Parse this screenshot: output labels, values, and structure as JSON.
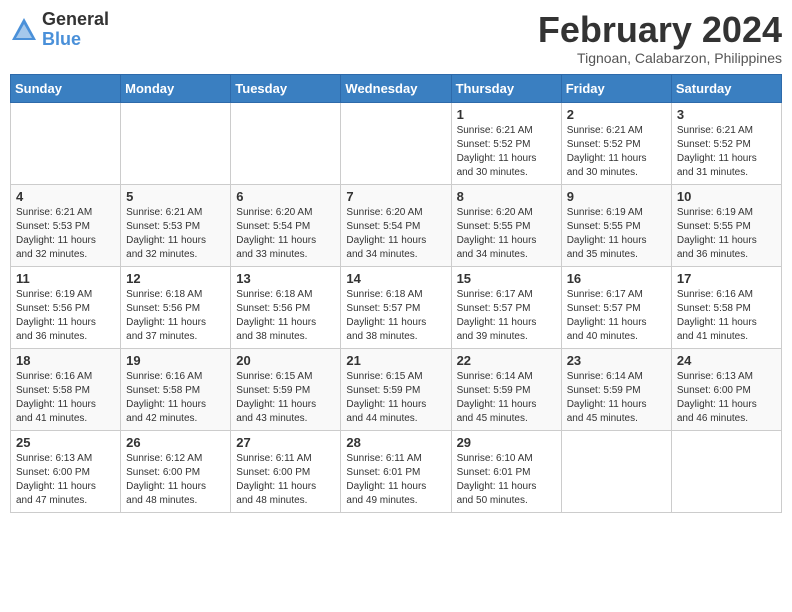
{
  "logo": {
    "text_general": "General",
    "text_blue": "Blue"
  },
  "header": {
    "month_title": "February 2024",
    "location": "Tignoan, Calabarzon, Philippines"
  },
  "days_of_week": [
    "Sunday",
    "Monday",
    "Tuesday",
    "Wednesday",
    "Thursday",
    "Friday",
    "Saturday"
  ],
  "weeks": [
    [
      {
        "day": "",
        "info": ""
      },
      {
        "day": "",
        "info": ""
      },
      {
        "day": "",
        "info": ""
      },
      {
        "day": "",
        "info": ""
      },
      {
        "day": "1",
        "info": "Sunrise: 6:21 AM\nSunset: 5:52 PM\nDaylight: 11 hours and 30 minutes."
      },
      {
        "day": "2",
        "info": "Sunrise: 6:21 AM\nSunset: 5:52 PM\nDaylight: 11 hours and 30 minutes."
      },
      {
        "day": "3",
        "info": "Sunrise: 6:21 AM\nSunset: 5:52 PM\nDaylight: 11 hours and 31 minutes."
      }
    ],
    [
      {
        "day": "4",
        "info": "Sunrise: 6:21 AM\nSunset: 5:53 PM\nDaylight: 11 hours and 32 minutes."
      },
      {
        "day": "5",
        "info": "Sunrise: 6:21 AM\nSunset: 5:53 PM\nDaylight: 11 hours and 32 minutes."
      },
      {
        "day": "6",
        "info": "Sunrise: 6:20 AM\nSunset: 5:54 PM\nDaylight: 11 hours and 33 minutes."
      },
      {
        "day": "7",
        "info": "Sunrise: 6:20 AM\nSunset: 5:54 PM\nDaylight: 11 hours and 34 minutes."
      },
      {
        "day": "8",
        "info": "Sunrise: 6:20 AM\nSunset: 5:55 PM\nDaylight: 11 hours and 34 minutes."
      },
      {
        "day": "9",
        "info": "Sunrise: 6:19 AM\nSunset: 5:55 PM\nDaylight: 11 hours and 35 minutes."
      },
      {
        "day": "10",
        "info": "Sunrise: 6:19 AM\nSunset: 5:55 PM\nDaylight: 11 hours and 36 minutes."
      }
    ],
    [
      {
        "day": "11",
        "info": "Sunrise: 6:19 AM\nSunset: 5:56 PM\nDaylight: 11 hours and 36 minutes."
      },
      {
        "day": "12",
        "info": "Sunrise: 6:18 AM\nSunset: 5:56 PM\nDaylight: 11 hours and 37 minutes."
      },
      {
        "day": "13",
        "info": "Sunrise: 6:18 AM\nSunset: 5:56 PM\nDaylight: 11 hours and 38 minutes."
      },
      {
        "day": "14",
        "info": "Sunrise: 6:18 AM\nSunset: 5:57 PM\nDaylight: 11 hours and 38 minutes."
      },
      {
        "day": "15",
        "info": "Sunrise: 6:17 AM\nSunset: 5:57 PM\nDaylight: 11 hours and 39 minutes."
      },
      {
        "day": "16",
        "info": "Sunrise: 6:17 AM\nSunset: 5:57 PM\nDaylight: 11 hours and 40 minutes."
      },
      {
        "day": "17",
        "info": "Sunrise: 6:16 AM\nSunset: 5:58 PM\nDaylight: 11 hours and 41 minutes."
      }
    ],
    [
      {
        "day": "18",
        "info": "Sunrise: 6:16 AM\nSunset: 5:58 PM\nDaylight: 11 hours and 41 minutes."
      },
      {
        "day": "19",
        "info": "Sunrise: 6:16 AM\nSunset: 5:58 PM\nDaylight: 11 hours and 42 minutes."
      },
      {
        "day": "20",
        "info": "Sunrise: 6:15 AM\nSunset: 5:59 PM\nDaylight: 11 hours and 43 minutes."
      },
      {
        "day": "21",
        "info": "Sunrise: 6:15 AM\nSunset: 5:59 PM\nDaylight: 11 hours and 44 minutes."
      },
      {
        "day": "22",
        "info": "Sunrise: 6:14 AM\nSunset: 5:59 PM\nDaylight: 11 hours and 45 minutes."
      },
      {
        "day": "23",
        "info": "Sunrise: 6:14 AM\nSunset: 5:59 PM\nDaylight: 11 hours and 45 minutes."
      },
      {
        "day": "24",
        "info": "Sunrise: 6:13 AM\nSunset: 6:00 PM\nDaylight: 11 hours and 46 minutes."
      }
    ],
    [
      {
        "day": "25",
        "info": "Sunrise: 6:13 AM\nSunset: 6:00 PM\nDaylight: 11 hours and 47 minutes."
      },
      {
        "day": "26",
        "info": "Sunrise: 6:12 AM\nSunset: 6:00 PM\nDaylight: 11 hours and 48 minutes."
      },
      {
        "day": "27",
        "info": "Sunrise: 6:11 AM\nSunset: 6:00 PM\nDaylight: 11 hours and 48 minutes."
      },
      {
        "day": "28",
        "info": "Sunrise: 6:11 AM\nSunset: 6:01 PM\nDaylight: 11 hours and 49 minutes."
      },
      {
        "day": "29",
        "info": "Sunrise: 6:10 AM\nSunset: 6:01 PM\nDaylight: 11 hours and 50 minutes."
      },
      {
        "day": "",
        "info": ""
      },
      {
        "day": "",
        "info": ""
      }
    ]
  ]
}
